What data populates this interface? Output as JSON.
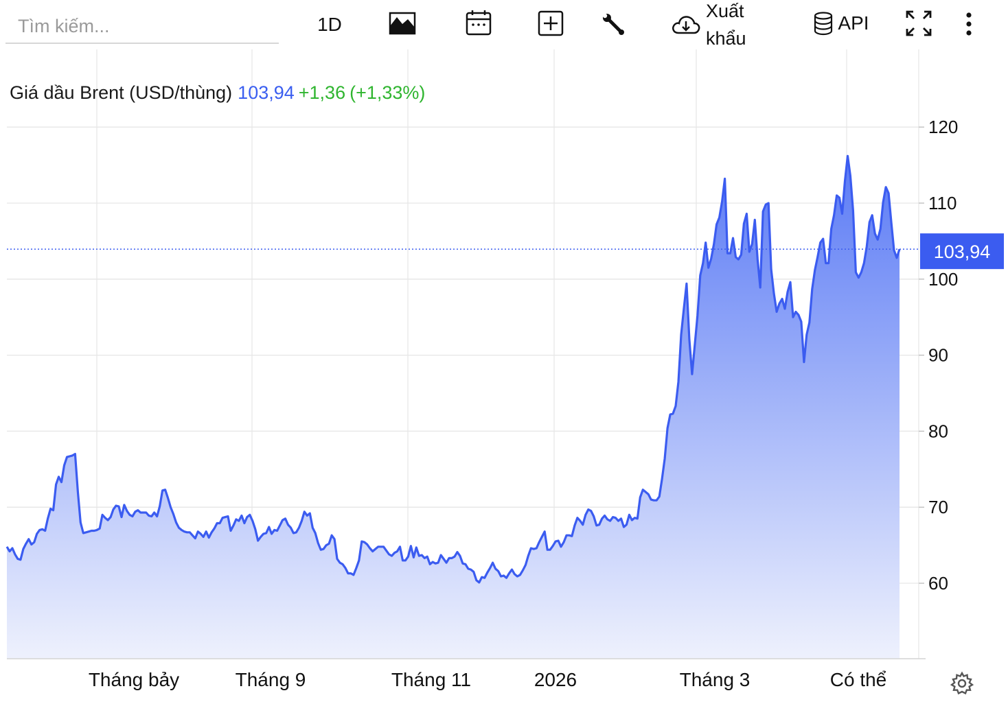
{
  "search": {
    "placeholder": "Tìm kiếm..."
  },
  "toolbar": {
    "interval_label": "1D",
    "export_label_line1": "Xuất",
    "export_label_line2": "khẩu",
    "api_label": "API"
  },
  "legend": {
    "series_name": "Giá dầu Brent (USD/thùng)",
    "last_price": "103,94",
    "change": "+1,36",
    "change_pct": "(+1,33%)"
  },
  "price_tag": "103,94",
  "colors": {
    "line": "#3b5cf0",
    "fill_top": "#5a7af5",
    "fill_bottom": "#eef1fd",
    "up": "#2fb52f",
    "tag_bg": "#3b5cf0"
  },
  "chart_data": {
    "type": "area",
    "ylim": [
      50,
      124
    ],
    "y_ticks": [
      "60",
      "70",
      "80",
      "90",
      "100",
      "110",
      "120"
    ],
    "x_tick_labels": [
      "Tháng bảy",
      "Tháng 9",
      "Tháng 11",
      "2026",
      "Tháng 3",
      "Có thể"
    ],
    "last_value": 103.94,
    "grid": true,
    "series": [
      {
        "values": [
          64.8,
          64.2,
          64.6,
          63.8,
          63.2,
          63.1,
          64.5,
          65.2,
          65.8,
          65.1,
          65.4,
          66.5,
          67.0,
          67.1,
          66.9,
          68.5,
          69.8,
          69.6,
          73.0,
          74.0,
          73.3,
          75.5,
          76.6,
          76.7,
          76.8,
          77.0,
          72.0,
          68.0,
          66.6,
          66.7,
          66.8,
          66.9,
          66.9,
          67.0,
          67.2,
          69.0,
          68.6,
          68.3,
          68.7,
          69.7,
          70.2,
          70.1,
          68.7,
          70.3,
          69.5,
          69.0,
          68.8,
          69.4,
          69.6,
          69.3,
          69.3,
          69.3,
          68.9,
          68.8,
          69.3,
          68.8,
          70.1,
          72.2,
          72.3,
          71.2,
          70.0,
          69.1,
          68.0,
          67.3,
          67.0,
          66.8,
          66.7,
          66.7,
          66.3,
          65.9,
          66.8,
          66.5,
          66.1,
          66.8,
          66.0,
          66.7,
          67.2,
          67.9,
          67.9,
          68.6,
          68.7,
          68.8,
          66.9,
          67.6,
          68.4,
          68.2,
          68.9,
          67.9,
          68.7,
          69.0,
          68.2,
          67.1,
          65.6,
          66.1,
          66.5,
          66.6,
          67.4,
          66.5,
          67.0,
          66.9,
          67.6,
          68.3,
          68.5,
          67.7,
          67.3,
          66.6,
          66.7,
          67.3,
          68.2,
          69.4,
          68.9,
          69.2,
          67.3,
          66.6,
          65.3,
          64.4,
          64.5,
          65.0,
          65.2,
          66.3,
          65.8,
          63.2,
          62.7,
          62.5,
          62.0,
          61.3,
          61.3,
          61.1,
          62.0,
          63.0,
          65.5,
          65.4,
          65.1,
          64.6,
          64.2,
          64.5,
          64.8,
          64.8,
          64.8,
          64.3,
          63.8,
          63.6,
          64.0,
          64.2,
          64.8,
          63.0,
          63.0,
          63.5,
          64.9,
          63.4,
          64.7,
          63.6,
          63.7,
          63.3,
          63.5,
          62.5,
          62.8,
          62.6,
          62.7,
          63.7,
          63.2,
          62.7,
          63.3,
          63.3,
          63.5,
          64.1,
          63.6,
          62.6,
          62.5,
          61.9,
          61.8,
          61.5,
          60.4,
          60.1,
          60.8,
          60.7,
          61.4,
          62.0,
          62.7,
          61.9,
          61.6,
          60.9,
          61.0,
          60.7,
          61.3,
          61.8,
          61.2,
          60.9,
          61.1,
          61.7,
          62.4,
          63.6,
          64.6,
          64.5,
          64.6,
          65.4,
          66.1,
          66.8,
          64.4,
          64.4,
          64.9,
          65.5,
          65.6,
          64.8,
          65.4,
          66.3,
          66.3,
          66.2,
          67.6,
          68.6,
          68.2,
          67.7,
          69.0,
          69.7,
          69.5,
          68.8,
          67.6,
          67.7,
          68.5,
          68.9,
          68.4,
          68.2,
          68.7,
          68.6,
          68.2,
          68.5,
          67.4,
          67.7,
          69.0,
          68.3,
          68.6,
          68.5,
          71.3,
          72.3,
          72.0,
          71.7,
          71.0,
          70.9,
          70.9,
          71.4,
          73.7,
          76.4,
          80.4,
          82.2,
          82.3,
          83.3,
          86.5,
          92.7,
          96.1,
          99.4,
          92.1,
          87.5,
          91.3,
          95.2,
          100.5,
          102.1,
          104.8,
          101.5,
          102.7,
          104.6,
          107.2,
          108.1,
          110.2,
          113.2,
          103.4,
          103.4,
          105.4,
          102.9,
          102.6,
          103.2,
          107.3,
          108.6,
          103.6,
          104.6,
          107.8,
          102.6,
          98.9,
          108.9,
          109.8,
          110.0,
          101.3,
          98.1,
          95.7,
          96.8,
          97.4,
          96.1,
          98.3,
          99.6,
          95.0,
          95.7,
          95.3,
          94.4,
          89.1,
          92.7,
          94.3,
          98.7,
          101.2,
          102.9,
          104.8,
          105.3,
          102.1,
          102.1,
          106.6,
          108.4,
          111.0,
          110.7,
          108.6,
          112.9,
          116.2,
          113.6,
          109.0,
          100.9,
          100.2,
          100.9,
          102.1,
          104.3,
          107.5,
          108.4,
          106.0,
          105.2,
          106.6,
          110.1,
          112.1,
          111.3,
          107.4,
          103.8,
          102.8,
          103.94
        ]
      }
    ]
  }
}
